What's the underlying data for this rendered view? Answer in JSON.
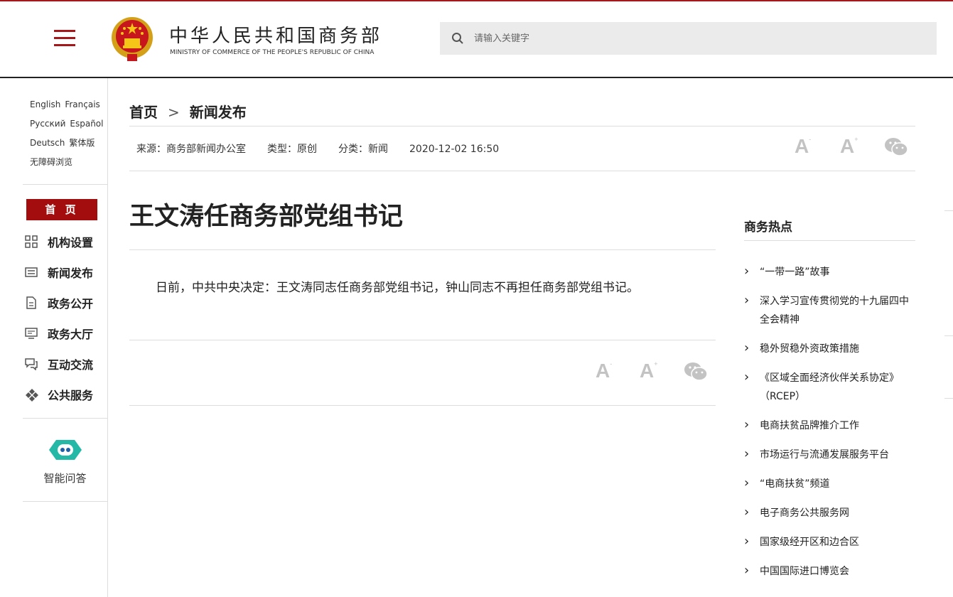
{
  "header": {
    "ministry_cn": "中华人民共和国商务部",
    "ministry_en": "MINISTRY OF COMMERCE OF THE PEOPLE'S REPUBLIC OF CHINA",
    "search_placeholder": "请输入关键字"
  },
  "sidebar": {
    "languages": [
      [
        "English",
        "Français"
      ],
      [
        "Русский",
        "Español"
      ],
      [
        "Deutsch",
        "繁体版"
      ],
      [
        "无障碍浏览"
      ]
    ],
    "home": "首 页",
    "nav": [
      {
        "label": "机构设置",
        "icon": "grid-icon"
      },
      {
        "label": "新闻发布",
        "icon": "news-icon"
      },
      {
        "label": "政务公开",
        "icon": "document-icon"
      },
      {
        "label": "政务大厅",
        "icon": "monitor-icon"
      },
      {
        "label": "互动交流",
        "icon": "chat-icon"
      },
      {
        "label": "公共服务",
        "icon": "service-icon"
      }
    ],
    "assistant_label": "智能问答"
  },
  "breadcrumb": {
    "home": "首页",
    "sep": ">",
    "current": "新闻发布"
  },
  "meta": {
    "source": "来源：商务部新闻办公室",
    "type": "类型：原创",
    "category": "分类：新闻",
    "datetime": "2020-12-02 16:50"
  },
  "tools": {
    "font_small": "A",
    "font_small_sup": "-",
    "font_large": "A",
    "font_large_sup": "+",
    "share_icon": "wechat-icon"
  },
  "article": {
    "title": "王文涛任商务部党组书记",
    "body": "日前，中共中央决定：王文涛同志任商务部党组书记，钟山同志不再担任商务部党组书记。"
  },
  "hot": {
    "title": "商务热点",
    "items": [
      "“一带一路”故事",
      "深入学习宣传贯彻党的十九届四中全会精神",
      "稳外贸稳外资政策措施",
      "《区域全面经济伙伴关系协定》（RCEP）",
      "电商扶贫品牌推介工作",
      "市场运行与流通发展服务平台",
      "“电商扶贫”频道",
      "电子商务公共服务网",
      "国家级经开区和边合区",
      "中国国际进口博览会"
    ]
  },
  "colors": {
    "brand": "#a30d0d",
    "tool_gray": "#c3c3c3"
  }
}
